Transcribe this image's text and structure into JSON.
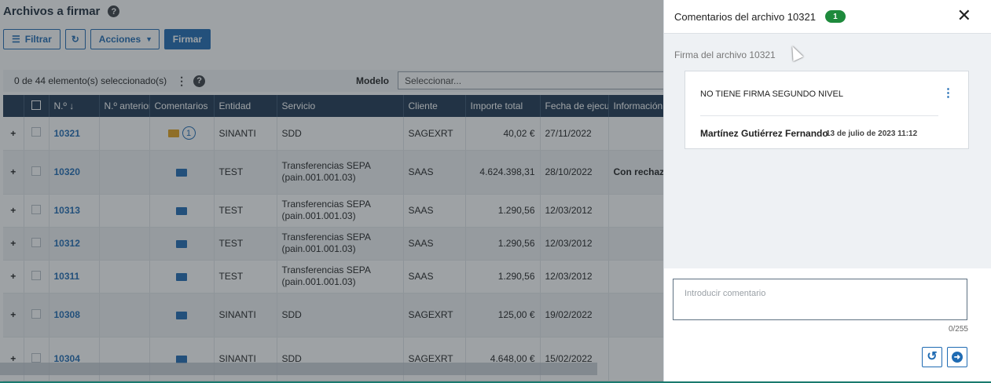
{
  "page": {
    "title": "Archivos a firmar",
    "help_glyph": "?"
  },
  "toolbar": {
    "filter_label": "Filtrar",
    "actions_label": "Acciones",
    "sign_label": "Firmar"
  },
  "selection": {
    "text": "0 de 44 elemento(s) seleccionado(s)",
    "modelo_label": "Modelo",
    "modelo_placeholder": "Seleccionar..."
  },
  "table": {
    "columns": [
      "N.º ↓",
      "N.º anterior",
      "Comentarios",
      "Entidad",
      "Servicio",
      "Cliente",
      "Importe total",
      "Fecha de ejecu...",
      "Información"
    ],
    "rows": [
      {
        "id": "10321",
        "anterior": "",
        "comment_count": "1",
        "entidad": "SINANTI",
        "servicio": "SDD",
        "cliente": "SAGEXRT",
        "importe": "40,02 €",
        "fecha": "27/11/2022",
        "info": ""
      },
      {
        "id": "10320",
        "anterior": "",
        "comment_count": "",
        "entidad": "TEST",
        "servicio": "Transferencias SEPA (pain.001.001.03)",
        "cliente": "SAAS",
        "importe": "4.624.398,31",
        "fecha": "28/10/2022",
        "info": "Con rechazos"
      },
      {
        "id": "10313",
        "anterior": "",
        "comment_count": "",
        "entidad": "TEST",
        "servicio": "Transferencias SEPA (pain.001.001.03)",
        "cliente": "SAAS",
        "importe": "1.290,56",
        "fecha": "12/03/2012",
        "info": ""
      },
      {
        "id": "10312",
        "anterior": "",
        "comment_count": "",
        "entidad": "TEST",
        "servicio": "Transferencias SEPA (pain.001.001.03)",
        "cliente": "SAAS",
        "importe": "1.290,56",
        "fecha": "12/03/2012",
        "info": ""
      },
      {
        "id": "10311",
        "anterior": "",
        "comment_count": "",
        "entidad": "TEST",
        "servicio": "Transferencias SEPA (pain.001.001.03)",
        "cliente": "SAAS",
        "importe": "1.290,56",
        "fecha": "12/03/2012",
        "info": ""
      },
      {
        "id": "10308",
        "anterior": "",
        "comment_count": "",
        "entidad": "SINANTI",
        "servicio": "SDD",
        "cliente": "SAGEXRT",
        "importe": "125,00 €",
        "fecha": "19/02/2022",
        "info": ""
      },
      {
        "id": "10304",
        "anterior": "",
        "comment_count": "",
        "entidad": "SINANTI",
        "servicio": "SDD",
        "cliente": "SAGEXRT",
        "importe": "4.648,00 €",
        "fecha": "15/02/2022",
        "info": ""
      }
    ]
  },
  "panel": {
    "title": "Comentarios del archivo 10321",
    "count": "1",
    "section_label": "Firma del archivo 10321",
    "comment": {
      "text": "NO TIENE FIRMA SEGUNDO NIVEL",
      "author": "Martínez Gutiérrez Fernando",
      "date": "13 de julio de 2023 11:12"
    },
    "input_placeholder": "Introducir comentario",
    "char_count": "0/255"
  },
  "colors": {
    "primary": "#1f6bb3",
    "header_bg": "#1e3650",
    "badge_green": "#1e8a3c",
    "unread_mail": "#e4a11b"
  }
}
